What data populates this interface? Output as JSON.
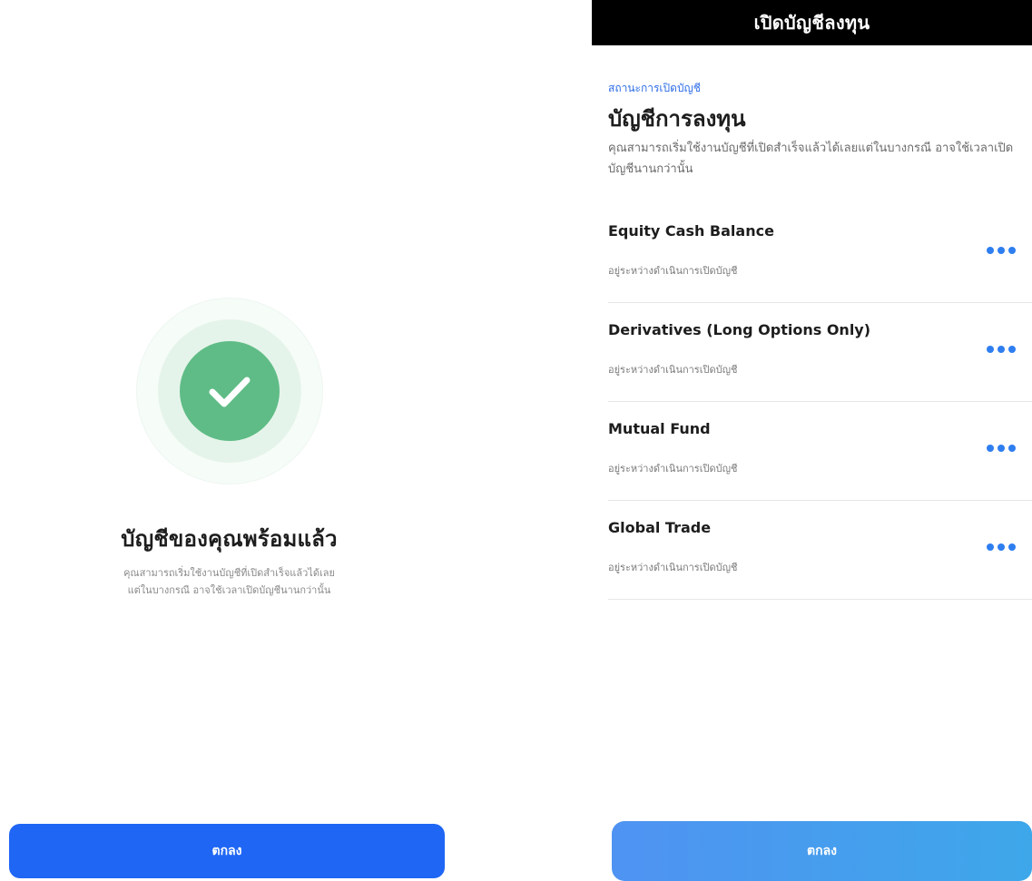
{
  "left": {
    "title": "บัญชีของคุณพร้อมแล้ว",
    "description_line1": "คุณสามารถเริ่มใช้งานบัญชีที่เปิดสำเร็จแล้วได้เลย",
    "description_line2": "แต่ในบางกรณี อาจใช้เวลาเปิดบัญชีนานกว่านั้น",
    "confirm_label": "ตกลง",
    "icon": "check-icon",
    "colors": {
      "success": "#5fbc86",
      "button": "#1f66f5"
    }
  },
  "right": {
    "header_title": "เปิดบัญชีลงทุน",
    "status_label": "สถานะการเปิดบัญชี",
    "section_title": "บัญชีการลงทุน",
    "section_desc": "คุณสามารถเริ่มใช้งานบัญชีที่เปิดสำเร็จแล้วได้เลยแต่ในบางกรณี อาจใช้เวลาเปิดบัญชีนานกว่านั้น",
    "accounts": [
      {
        "name": "Equity Cash Balance",
        "status": "อยู่ระหว่างดำเนินการเปิดบัญชี"
      },
      {
        "name": "Derivatives (Long Options Only)",
        "status": "อยู่ระหว่างดำเนินการเปิดบัญชี"
      },
      {
        "name": "Mutual Fund",
        "status": "อยู่ระหว่างดำเนินการเปิดบัญชี"
      },
      {
        "name": "Global Trade",
        "status": "อยู่ระหว่างดำเนินการเปิดบัญชี"
      }
    ],
    "more_icon": "more-dots-icon",
    "confirm_label": "ตกลง",
    "colors": {
      "accent": "#2f7ef0",
      "header": "#000000"
    }
  }
}
